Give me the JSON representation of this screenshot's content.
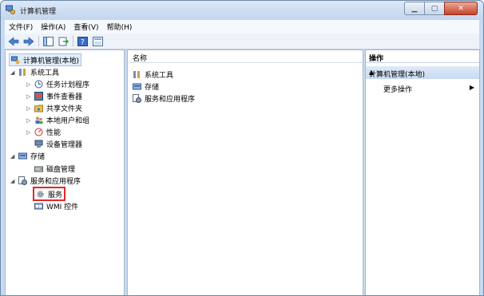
{
  "window": {
    "title": "计算机管理"
  },
  "menu": [
    "文件(F)",
    "操作(A)",
    "查看(V)",
    "帮助(H)"
  ],
  "toolbar": [
    "back-icon",
    "forward-icon",
    "show-hide-tree-icon",
    "export-list-icon",
    "help-icon",
    "properties-icon"
  ],
  "tree": {
    "root": "计算机管理(本地)",
    "system_tools": "系统工具",
    "task_scheduler": "任务计划程序",
    "event_viewer": "事件查看器",
    "shared_folders": "共享文件夹",
    "local_users": "本地用户和组",
    "performance": "性能",
    "device_manager": "设备管理器",
    "storage": "存储",
    "disk_management": "磁盘管理",
    "services_apps": "服务和应用程序",
    "services": "服务",
    "wmi": "WMI 控件"
  },
  "list": {
    "column": "名称",
    "rows": [
      "系统工具",
      "存储",
      "服务和应用程序"
    ]
  },
  "actions": {
    "header": "操作",
    "section": "计算机管理(本地)",
    "more": "更多操作"
  },
  "colors": {
    "selection_outline": "#e0282a",
    "titlebar": "#c3d6ee",
    "action_section": "#c9daf1"
  }
}
